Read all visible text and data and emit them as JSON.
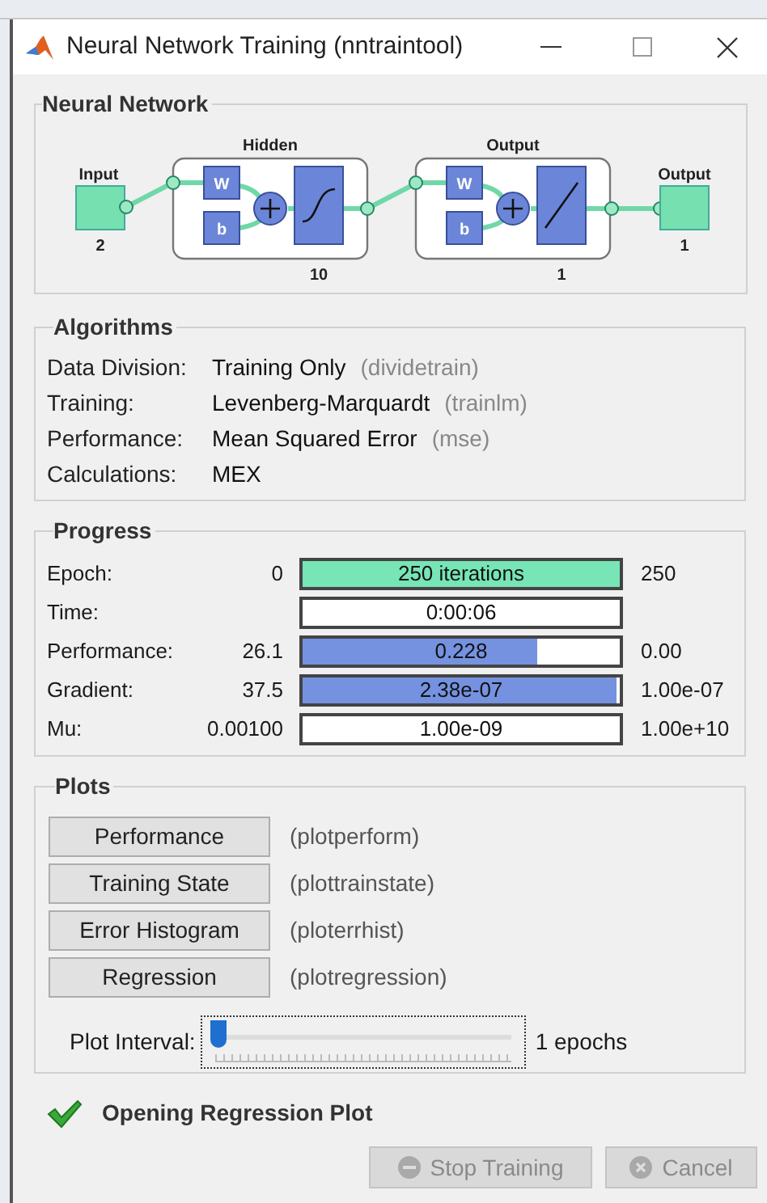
{
  "window": {
    "title": "Neural Network Training (nntraintool)"
  },
  "network": {
    "title": "Neural Network",
    "input": {
      "label": "Input",
      "size": "2"
    },
    "layers": [
      {
        "name": "Hidden",
        "size": "10",
        "kind": "sigmoid",
        "weight": "W",
        "bias": "b"
      },
      {
        "name": "Output",
        "size": "1",
        "kind": "linear",
        "weight": "W",
        "bias": "b"
      }
    ],
    "output": {
      "label": "Output",
      "size": "1"
    }
  },
  "algorithms": {
    "title": "Algorithms",
    "rows": [
      {
        "label": "Data Division:",
        "value": "Training Only",
        "function": "(dividetrain)"
      },
      {
        "label": "Training:",
        "value": "Levenberg-Marquardt",
        "function": "(trainlm)"
      },
      {
        "label": "Performance:",
        "value": "Mean Squared Error",
        "function": "(mse)"
      },
      {
        "label": "Calculations:",
        "value": "MEX"
      }
    ]
  },
  "progress": {
    "title": "Progress",
    "rows": [
      {
        "label": "Epoch:",
        "start": "0",
        "text": "250 iterations",
        "end": "250",
        "level": 1,
        "color": "#77e5b6"
      },
      {
        "label": "Time:",
        "text": "0:00:06",
        "level": 0
      },
      {
        "label": "Performance:",
        "start": "26.1",
        "text": "0.228",
        "end": "0.00",
        "level": 0.74,
        "color": "#7592e0"
      },
      {
        "label": "Gradient:",
        "start": "37.5",
        "text": "2.38e-07",
        "end": "1.00e-07",
        "level": 0.99,
        "color": "#7592e0"
      },
      {
        "label": "Mu:",
        "start": "0.00100",
        "text": "1.00e-09",
        "end": "1.00e+10",
        "level": 0
      }
    ]
  },
  "plots": {
    "title": "Plots",
    "buttons": [
      {
        "label": "Performance",
        "function": "(plotperform)"
      },
      {
        "label": "Training State",
        "function": "(plottrainstate)"
      },
      {
        "label": "Error Histogram",
        "function": "(ploterrhist)"
      },
      {
        "label": "Regression",
        "function": "(plotregression)"
      }
    ],
    "interval": {
      "label": "Plot Interval:",
      "level": 0,
      "value": "1 epochs"
    }
  },
  "status": {
    "text": "Opening Regression Plot"
  },
  "buttons": [
    {
      "label": "Stop Training",
      "kind": "stop",
      "disabled": true
    },
    {
      "label": "Cancel",
      "kind": "cancel",
      "disabled": true
    }
  ]
}
